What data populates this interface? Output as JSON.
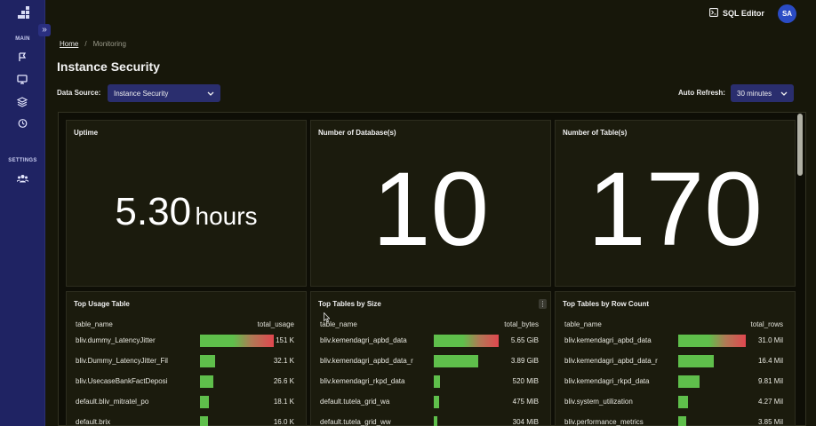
{
  "sidebar": {
    "section_main": "MAIN",
    "section_settings": "SETTINGS",
    "collapse_glyph": "»"
  },
  "header": {
    "sql_editor": "SQL Editor",
    "avatar": "SA"
  },
  "breadcrumb": {
    "home": "Home",
    "separator": "/",
    "current": "Monitoring"
  },
  "page": {
    "title": "Instance Security"
  },
  "controls": {
    "data_source_label": "Data Source:",
    "data_source_value": "Instance Security",
    "auto_refresh_label": "Auto Refresh:",
    "auto_refresh_value": "30 minutes"
  },
  "stats": {
    "uptime": {
      "title": "Uptime",
      "value": "5.30",
      "unit": "hours"
    },
    "databases": {
      "title": "Number of Database(s)",
      "value": "10"
    },
    "tables": {
      "title": "Number of Table(s)",
      "value": "170"
    }
  },
  "tables": {
    "usage": {
      "title": "Top Usage Table",
      "col1": "table_name",
      "col2": "total_usage",
      "rows": [
        {
          "name": "bliv.dummy_LatencyJitter",
          "value": "151 K",
          "level": 1.0
        },
        {
          "name": "bliv.Dummy_LatencyJitter_Fil",
          "value": "32.1 K",
          "level": 0.21
        },
        {
          "name": "bliv.UsecaseBankFactDeposi",
          "value": "26.6 K",
          "level": 0.18
        },
        {
          "name": "default.bliv_mitratel_po",
          "value": "18.1 K",
          "level": 0.12
        },
        {
          "name": "default.brix",
          "value": "16.0 K",
          "level": 0.11
        }
      ]
    },
    "size": {
      "title": "Top Tables by Size",
      "col1": "table_name",
      "col2": "total_bytes",
      "rows": [
        {
          "name": "bliv.kemendagri_apbd_data",
          "value": "5.65 GiB",
          "level": 1.0
        },
        {
          "name": "bliv.kemendagri_apbd_data_r",
          "value": "3.89 GiB",
          "level": 0.69
        },
        {
          "name": "bliv.kemendagri_rkpd_data",
          "value": "520 MiB",
          "level": 0.09
        },
        {
          "name": "default.tutela_grid_wa",
          "value": "475 MiB",
          "level": 0.08
        },
        {
          "name": "default.tutela_grid_ww",
          "value": "304 MiB",
          "level": 0.05
        }
      ]
    },
    "rows": {
      "title": "Top Tables by Row Count",
      "col1": "table_name",
      "col2": "total_rows",
      "rows": [
        {
          "name": "bliv.kemendagri_apbd_data",
          "value": "31.0 Mil",
          "level": 1.0
        },
        {
          "name": "bliv.kemendagri_apbd_data_r",
          "value": "16.4 Mil",
          "level": 0.53
        },
        {
          "name": "bliv.kemendagri_rkpd_data",
          "value": "9.81 Mil",
          "level": 0.32
        },
        {
          "name": "bliv.system_utilization",
          "value": "4.27 Mil",
          "level": 0.14
        },
        {
          "name": "bliv.performance_metrics",
          "value": "3.85 Mil",
          "level": 0.12
        }
      ]
    }
  },
  "colors": {
    "sidebar": "#1f2363",
    "bar_green": "#5fbf4b",
    "bar_red": "#e0474f",
    "avatar": "#2a4bc4"
  }
}
